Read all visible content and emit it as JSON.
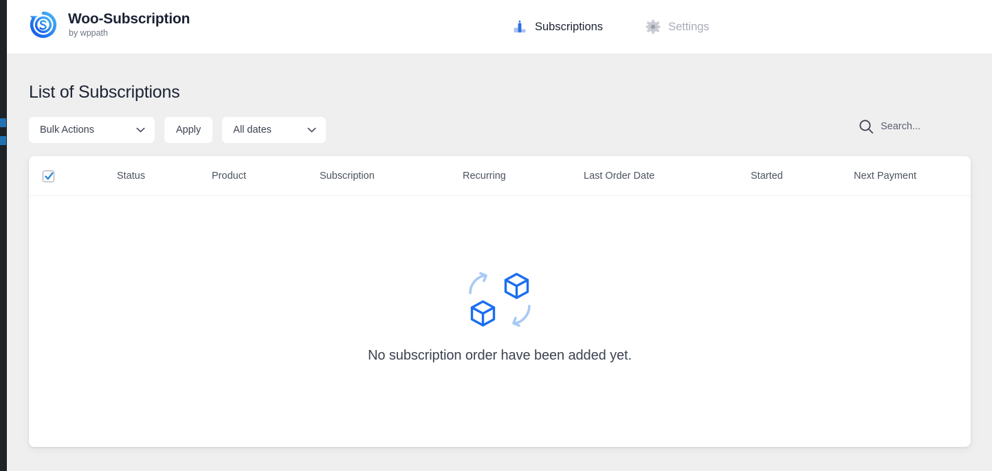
{
  "brand": {
    "logo_icon": "dollar-refresh-circle-icon",
    "title": "Woo-Subscription",
    "subtitle": "by wppath",
    "accent_color": "#1a73e8"
  },
  "topnav": {
    "items": [
      {
        "id": "subscriptions",
        "label": "Subscriptions",
        "icon": "person-podium-icon",
        "active": true
      },
      {
        "id": "settings",
        "label": "Settings",
        "icon": "gear-icon",
        "active": false
      }
    ]
  },
  "page": {
    "title": "List of Subscriptions"
  },
  "toolbar": {
    "bulk_actions": {
      "selected": "Bulk Actions",
      "options": [
        "Bulk Actions"
      ]
    },
    "apply_label": "Apply",
    "date_filter": {
      "selected": "All dates",
      "options": [
        "All dates"
      ]
    },
    "chevron_icon": "chevron-down-icon"
  },
  "search": {
    "icon": "search-icon",
    "placeholder": "Search...",
    "value": ""
  },
  "table": {
    "select_all_checked": true,
    "columns": [
      {
        "id": "select-all",
        "label": ""
      },
      {
        "id": "status",
        "label": "Status"
      },
      {
        "id": "product",
        "label": "Product"
      },
      {
        "id": "subscription",
        "label": "Subscription"
      },
      {
        "id": "recurring",
        "label": "Recurring"
      },
      {
        "id": "last-order-date",
        "label": "Last Order Date"
      },
      {
        "id": "started",
        "label": "Started"
      },
      {
        "id": "next-payment",
        "label": "Next Payment"
      }
    ],
    "rows": [],
    "empty_state": {
      "icon": "sync-boxes-icon",
      "message": "No subscription order have been added yet.",
      "icon_color": "#1a6ef0",
      "arrow_color": "#a9c9f5"
    }
  }
}
